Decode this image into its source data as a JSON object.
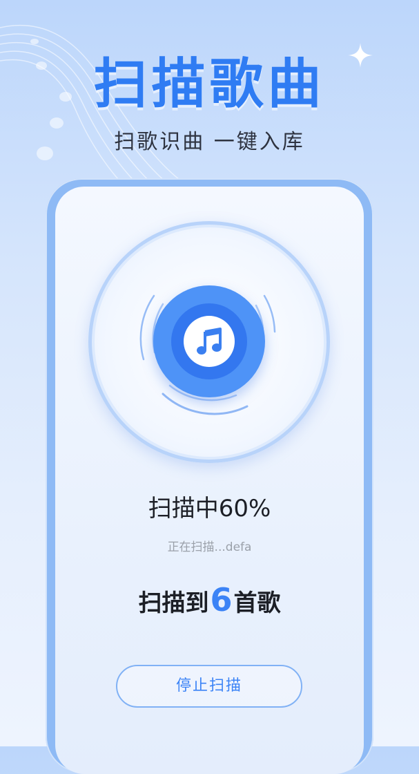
{
  "header": {
    "title": "扫描歌曲",
    "subtitle": "扫歌识曲 一键入库"
  },
  "scan": {
    "progress_label": "扫描中60%",
    "progress_percent": 60,
    "current_path": "正在扫描...defa",
    "found_prefix": "扫描到",
    "found_count": "6",
    "found_suffix": "首歌"
  },
  "actions": {
    "stop_label": "停止扫描"
  },
  "icons": {
    "center": "music-note-icon",
    "decoration": "music-staff-icon",
    "sparkle": "sparkle-icon"
  },
  "colors": {
    "accent": "#3b83f6",
    "title": "#2f7cf3",
    "disc": "#4e93f7"
  }
}
